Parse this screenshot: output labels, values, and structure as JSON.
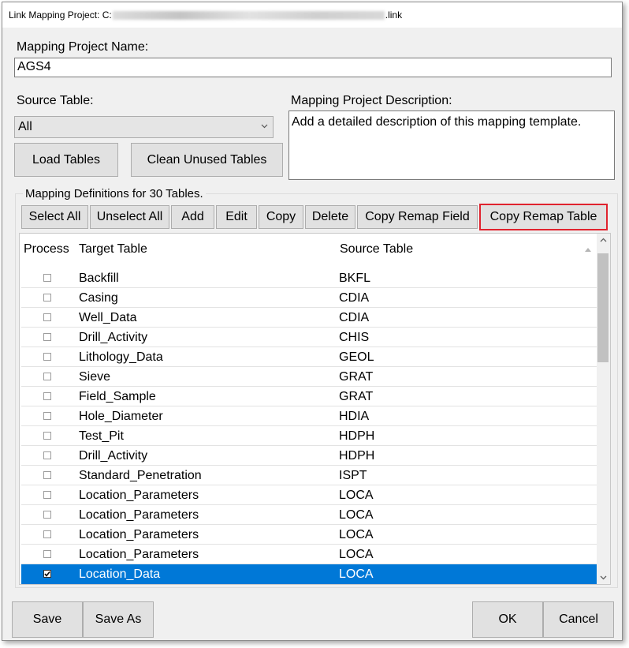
{
  "window": {
    "title_prefix": "Link Mapping Project: C:",
    "title_suffix": ".link"
  },
  "project": {
    "name_label": "Mapping Project Name:",
    "name_value": "AGS4"
  },
  "source": {
    "label": "Source Table:",
    "selected": "All"
  },
  "description": {
    "label": "Mapping Project Description:",
    "value": "Add a detailed description of this mapping template."
  },
  "buttons": {
    "load_tables": "Load Tables",
    "clean_unused_tables": "Clean Unused Tables",
    "save": "Save",
    "save_as": "Save As",
    "ok": "OK",
    "cancel": "Cancel"
  },
  "mapping": {
    "group_label": "Mapping Definitions for 30 Tables.",
    "toolbar": {
      "select_all": "Select All",
      "unselect_all": "Unselect All",
      "add": "Add",
      "edit": "Edit",
      "copy": "Copy",
      "delete": "Delete",
      "copy_remap_field": "Copy Remap Field",
      "copy_remap_table": "Copy Remap Table"
    },
    "columns": {
      "process": "Process",
      "target": "Target Table",
      "source": "Source Table"
    },
    "rows": [
      {
        "target": "Backfill",
        "source": "BKFL",
        "checked": false
      },
      {
        "target": "Casing",
        "source": "CDIA",
        "checked": false
      },
      {
        "target": "Well_Data",
        "source": "CDIA",
        "checked": false
      },
      {
        "target": "Drill_Activity",
        "source": "CHIS",
        "checked": false
      },
      {
        "target": "Lithology_Data",
        "source": "GEOL",
        "checked": false
      },
      {
        "target": "Sieve",
        "source": "GRAT",
        "checked": false
      },
      {
        "target": "Field_Sample",
        "source": "GRAT",
        "checked": false
      },
      {
        "target": "Hole_Diameter",
        "source": "HDIA",
        "checked": false
      },
      {
        "target": "Test_Pit",
        "source": "HDPH",
        "checked": false
      },
      {
        "target": "Drill_Activity",
        "source": "HDPH",
        "checked": false
      },
      {
        "target": "Standard_Penetration",
        "source": "ISPT",
        "checked": false
      },
      {
        "target": "Location_Parameters",
        "source": "LOCA",
        "checked": false
      },
      {
        "target": "Location_Parameters",
        "source": "LOCA",
        "checked": false
      },
      {
        "target": "Location_Parameters",
        "source": "LOCA",
        "checked": false
      },
      {
        "target": "Location_Parameters",
        "source": "LOCA",
        "checked": false
      },
      {
        "target": "Location_Data",
        "source": "LOCA",
        "checked": true,
        "selected": true
      }
    ]
  },
  "colors": {
    "selection": "#0078d7",
    "highlight_border": "#e0232e"
  }
}
